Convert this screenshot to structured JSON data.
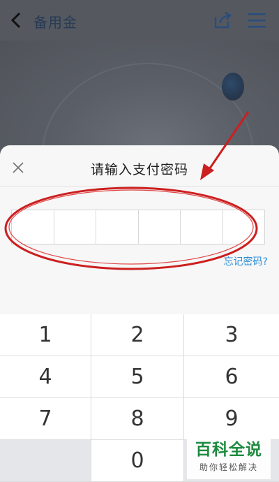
{
  "header": {
    "title": "备用金",
    "icons": {
      "back": "chevron-left-icon",
      "share": "share-icon",
      "menu": "hamburger-menu-icon"
    },
    "accent_color": "#2b4d7c"
  },
  "modal": {
    "title": "请输入支付密码",
    "forgot_password": "忘记密码?",
    "password_digits": 6,
    "link_color": "#2a8ed8"
  },
  "keypad": {
    "keys": [
      "1",
      "2",
      "3",
      "4",
      "5",
      "6",
      "7",
      "8",
      "9",
      "",
      "0",
      ""
    ]
  },
  "annotation": {
    "color": "#cc1f1f"
  },
  "watermark": {
    "main": "百科全说",
    "sub": "助你轻松解决"
  }
}
